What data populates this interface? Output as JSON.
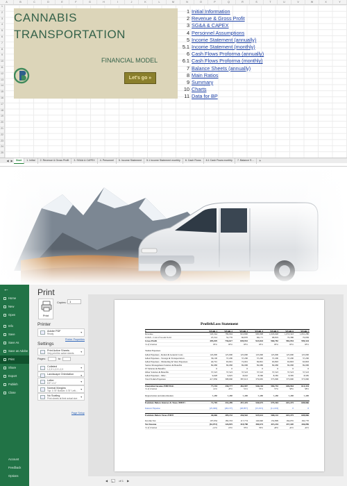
{
  "excel": {
    "columns": [
      "A",
      "B",
      "C",
      "D",
      "E",
      "F",
      "G",
      "H",
      "I",
      "J",
      "K",
      "L",
      "M",
      "N",
      "O",
      "P",
      "Q",
      "R",
      "S",
      "T",
      "U",
      "V",
      "W",
      "X",
      "Y"
    ],
    "rows": [
      "1",
      "2",
      "3",
      "4",
      "5",
      "6",
      "7",
      "8",
      "9",
      "10",
      "11",
      "12",
      "13",
      "14",
      "15",
      "16",
      "17",
      "18",
      "19",
      "20",
      "21",
      "22",
      "23",
      "24",
      "25"
    ],
    "title_line1": "CANNABIS",
    "title_line2": "TRANSPORTATION",
    "subtitle": "FINANCIAL MODEL",
    "button_label": "Let's go »",
    "toc": [
      {
        "num": "1",
        "label": "Initial Information"
      },
      {
        "num": "2",
        "label": "Revenue & Gross Profit"
      },
      {
        "num": "3",
        "label": "SG&A & CAPEX"
      },
      {
        "num": "4",
        "label": "Personnel Assumptions"
      },
      {
        "num": "5",
        "label": "Income Statement (annually)"
      },
      {
        "num": "5.1",
        "label": "Income Statement (monthly)"
      },
      {
        "num": "6",
        "label": "Cash Flows Proforma (annually)"
      },
      {
        "num": "6.1",
        "label": "Cash Flows Proforma (monthly)"
      },
      {
        "num": "7",
        "label": "Balance Sheets (annually)"
      },
      {
        "num": "8",
        "label": "Main Ratios"
      },
      {
        "num": "9",
        "label": "Summary"
      },
      {
        "num": "10",
        "label": "Charts"
      },
      {
        "num": "11",
        "label": "Data for BP"
      }
    ],
    "tabs": [
      "Start",
      "1. Initial",
      "2. Revenue & Gross Profit",
      "3. SG&A & CAPEX",
      "4. Personnel",
      "5. Income Statement",
      "5.1 Income Statement monthly",
      "6. Cash Flows",
      "6.1 Cash Flows monthly",
      "7. Balance S ..."
    ],
    "tab_add": "+",
    "colors": {
      "title_box": "#dcd5b9",
      "title_text": "#35624a",
      "button": "#8a7f2c",
      "link": "#1a3fa6",
      "excel_green": "#217346"
    }
  },
  "print": {
    "back": "←",
    "nav": [
      "Home",
      "New",
      "Open",
      "Info",
      "Save",
      "Save As",
      "Save as Adobe PDF",
      "Print",
      "Share",
      "Export",
      "Publish",
      "Close"
    ],
    "nav_selected": "Print",
    "nav_bottom": [
      "Account",
      "Feedback",
      "Options"
    ],
    "title": "Print",
    "print_button": "Print",
    "copies_label": "Copies:",
    "copies_value": "1",
    "printer_header": "Printer",
    "printer_name": "Adobe PDF",
    "printer_status": "Ready",
    "printer_properties": "Printer Properties",
    "settings_header": "Settings",
    "settings": [
      {
        "line1": "Print Active Sheets",
        "line2": "Only print the active sheets"
      },
      {
        "line1": "Collated",
        "line2": "1,2,3  1,2,3  1,2,3"
      },
      {
        "line1": "Landscape Orientation",
        "line2": ""
      },
      {
        "line1": "Letter",
        "line2": "8.5\" x 11\""
      },
      {
        "line1": "Normal Margins",
        "line2": "Top: 0.75\" Bottom: 0.75\" Left:..."
      },
      {
        "line1": "No Scaling",
        "line2": "Print sheets at their actual size"
      }
    ],
    "pages_label": "Pages:",
    "pages_to": "to",
    "page_setup": "Page Setup",
    "page_nav": {
      "current": "1",
      "of": "of 1"
    },
    "statement": {
      "title": "Profit&Loss Statement",
      "headers": [
        "",
        "YEAR 1",
        "YEAR 2",
        "YEAR 3",
        "YEAR 4",
        "YEAR 5",
        "YEAR 6",
        "YEAR 7"
      ],
      "rows": [
        {
          "style": "head",
          "cells": [
            "$",
            "YEAR 1",
            "YEAR 2",
            "YEAR 3",
            "YEAR 4",
            "YEAR 5",
            "YEAR 6",
            "YEAR 7"
          ]
        },
        {
          "style": "",
          "cells": [
            "Revenue",
            "520,344",
            "789,994",
            "910,800",
            "990,998",
            "1,029,648",
            "1,053,343",
            "1,061,280"
          ]
        },
        {
          "style": "",
          "cells": [
            "COGS - Cost of Goods Sold",
            "25,314",
            "52,776",
            "60,870",
            "66,171",
            "68,819",
            "70,386",
            "70,936"
          ]
        },
        {
          "style": "bold",
          "cells": [
            "Gross Profit",
            "495,029",
            "736,617",
            "849,932",
            "923,824",
            "960,782",
            "982,954",
            "990,344"
          ]
        },
        {
          "style": "ital",
          "cells": [
            "% of revenue",
            "95%",
            "93%",
            "93%",
            "93%",
            "93%",
            "93%",
            "93%"
          ]
        },
        {
          "style": "gap",
          "cells": [
            "",
            "",
            "",
            "",
            "",
            "",
            "",
            ""
          ]
        },
        {
          "style": "",
          "cells": [
            "SG&A Expenses",
            "",
            "",
            "",
            "",
            "",
            "",
            ""
          ]
        },
        {
          "style": "",
          "cells": [
            "  G&A Expenses - Rental & General Costs",
            "145,000",
            "125,000",
            "125,000",
            "125,000",
            "125,000",
            "125,000",
            "125,000"
          ]
        },
        {
          "style": "",
          "cells": [
            "  G&A Expenses - Storage & Transportation",
            "36,100",
            "37,200",
            "37,200",
            "37,200",
            "37,200",
            "37,200",
            "37,200"
          ]
        },
        {
          "style": "",
          "cells": [
            "  G&A Expenses - Marketing & Sales Expenses",
            "40,791",
            "63,991",
            "72,991",
            "69,891",
            "63,893",
            "63,893",
            "63,893"
          ]
        },
        {
          "style": "",
          "cells": [
            "  Senior Management Salaries & Benefits",
            "89,988",
            "89,988",
            "89,988",
            "89,988",
            "89,988",
            "89,988",
            "89,988"
          ]
        },
        {
          "style": "",
          "cells": [
            "  IT Salaries & Benefits",
            "0",
            "0",
            "0",
            "0",
            "0",
            "0",
            "0"
          ]
        },
        {
          "style": "",
          "cells": [
            "  Other Salaries & Benefits",
            "37,523",
            "37,523",
            "37,523",
            "37,523",
            "37,523",
            "37,523",
            "37,523"
          ]
        },
        {
          "style": "",
          "cells": [
            "  G&A Expenses - Misc.",
            "9,628",
            "9,625",
            "8,910",
            "8,560",
            "8,585",
            "8,585",
            "8,585"
          ]
        },
        {
          "style": "",
          "cells": [
            "Total SG&A Expenses",
            "417,836",
            "398,660",
            "387,613",
            "379,665",
            "373,990",
            "373,990",
            "373,990"
          ]
        },
        {
          "style": "gap",
          "cells": [
            "",
            "",
            "",
            "",
            "",
            "",
            "",
            ""
          ]
        },
        {
          "style": "bold topline",
          "cells": [
            "Operating Income (EBITDA)",
            "77,194",
            "338,777",
            "462,907",
            "546,164",
            "584,792",
            "606,964",
            "614,354"
          ]
        },
        {
          "style": "ital",
          "cells": [
            "% of revenue",
            "14%",
            "45%",
            "51%",
            "55%",
            "57%",
            "58%",
            "58%"
          ]
        },
        {
          "style": "gap",
          "cells": [
            "",
            "",
            "",
            "",
            "",
            "",
            "",
            ""
          ]
        },
        {
          "style": "",
          "cells": [
            "Depreciation and Amortization",
            "5,488",
            "5,488",
            "5,488",
            "5,488",
            "5,488",
            "5,488",
            "5,488"
          ]
        },
        {
          "style": "gap",
          "cells": [
            "",
            "",
            "",
            "",
            "",
            "",
            "",
            ""
          ]
        },
        {
          "style": "bold topline",
          "cells": [
            "Earnings Before Interest & Taxes (EBIT)",
            "71,705",
            "333,289",
            "457,419",
            "540,675",
            "579,304",
            "601,475",
            "608,866"
          ]
        },
        {
          "style": "gap",
          "cells": [
            "",
            "",
            "",
            "",
            "",
            "",
            "",
            ""
          ]
        },
        {
          "style": "blue",
          "cells": [
            "Interest Expense",
            "(25,049)",
            "(26,137)",
            "(20,857)",
            "(15,015)",
            "(11,163)",
            "0",
            "0"
          ]
        },
        {
          "style": "gap",
          "cells": [
            "",
            "",
            "",
            "",
            "",
            "",
            "",
            ""
          ]
        },
        {
          "style": "bold topline",
          "cells": [
            "Earnings Before Taxes (EBT)",
            "46,666",
            "309,152",
            "436,562",
            "525,614",
            "568,142",
            "601,475",
            "608,866"
          ]
        },
        {
          "style": "gap",
          "cells": [
            "",
            "",
            "",
            "",
            "",
            "",
            "",
            ""
          ]
        },
        {
          "style": "",
          "cells": [
            "Income Tax",
            "107,934",
            "182,333",
            "117,774",
            "140,940",
            "152,899",
            "164,055",
            "162,770"
          ]
        },
        {
          "style": "bold",
          "cells": [
            "Net Income",
            "(61,072)",
            "126,819",
            "318,788",
            "384,674",
            "415,244",
            "437,420",
            "446,096"
          ]
        },
        {
          "style": "ital",
          "cells": [
            "% of revenue",
            "-12%",
            "16%",
            "35%",
            "39%",
            "40%",
            "42%",
            "42%"
          ]
        }
      ]
    }
  }
}
